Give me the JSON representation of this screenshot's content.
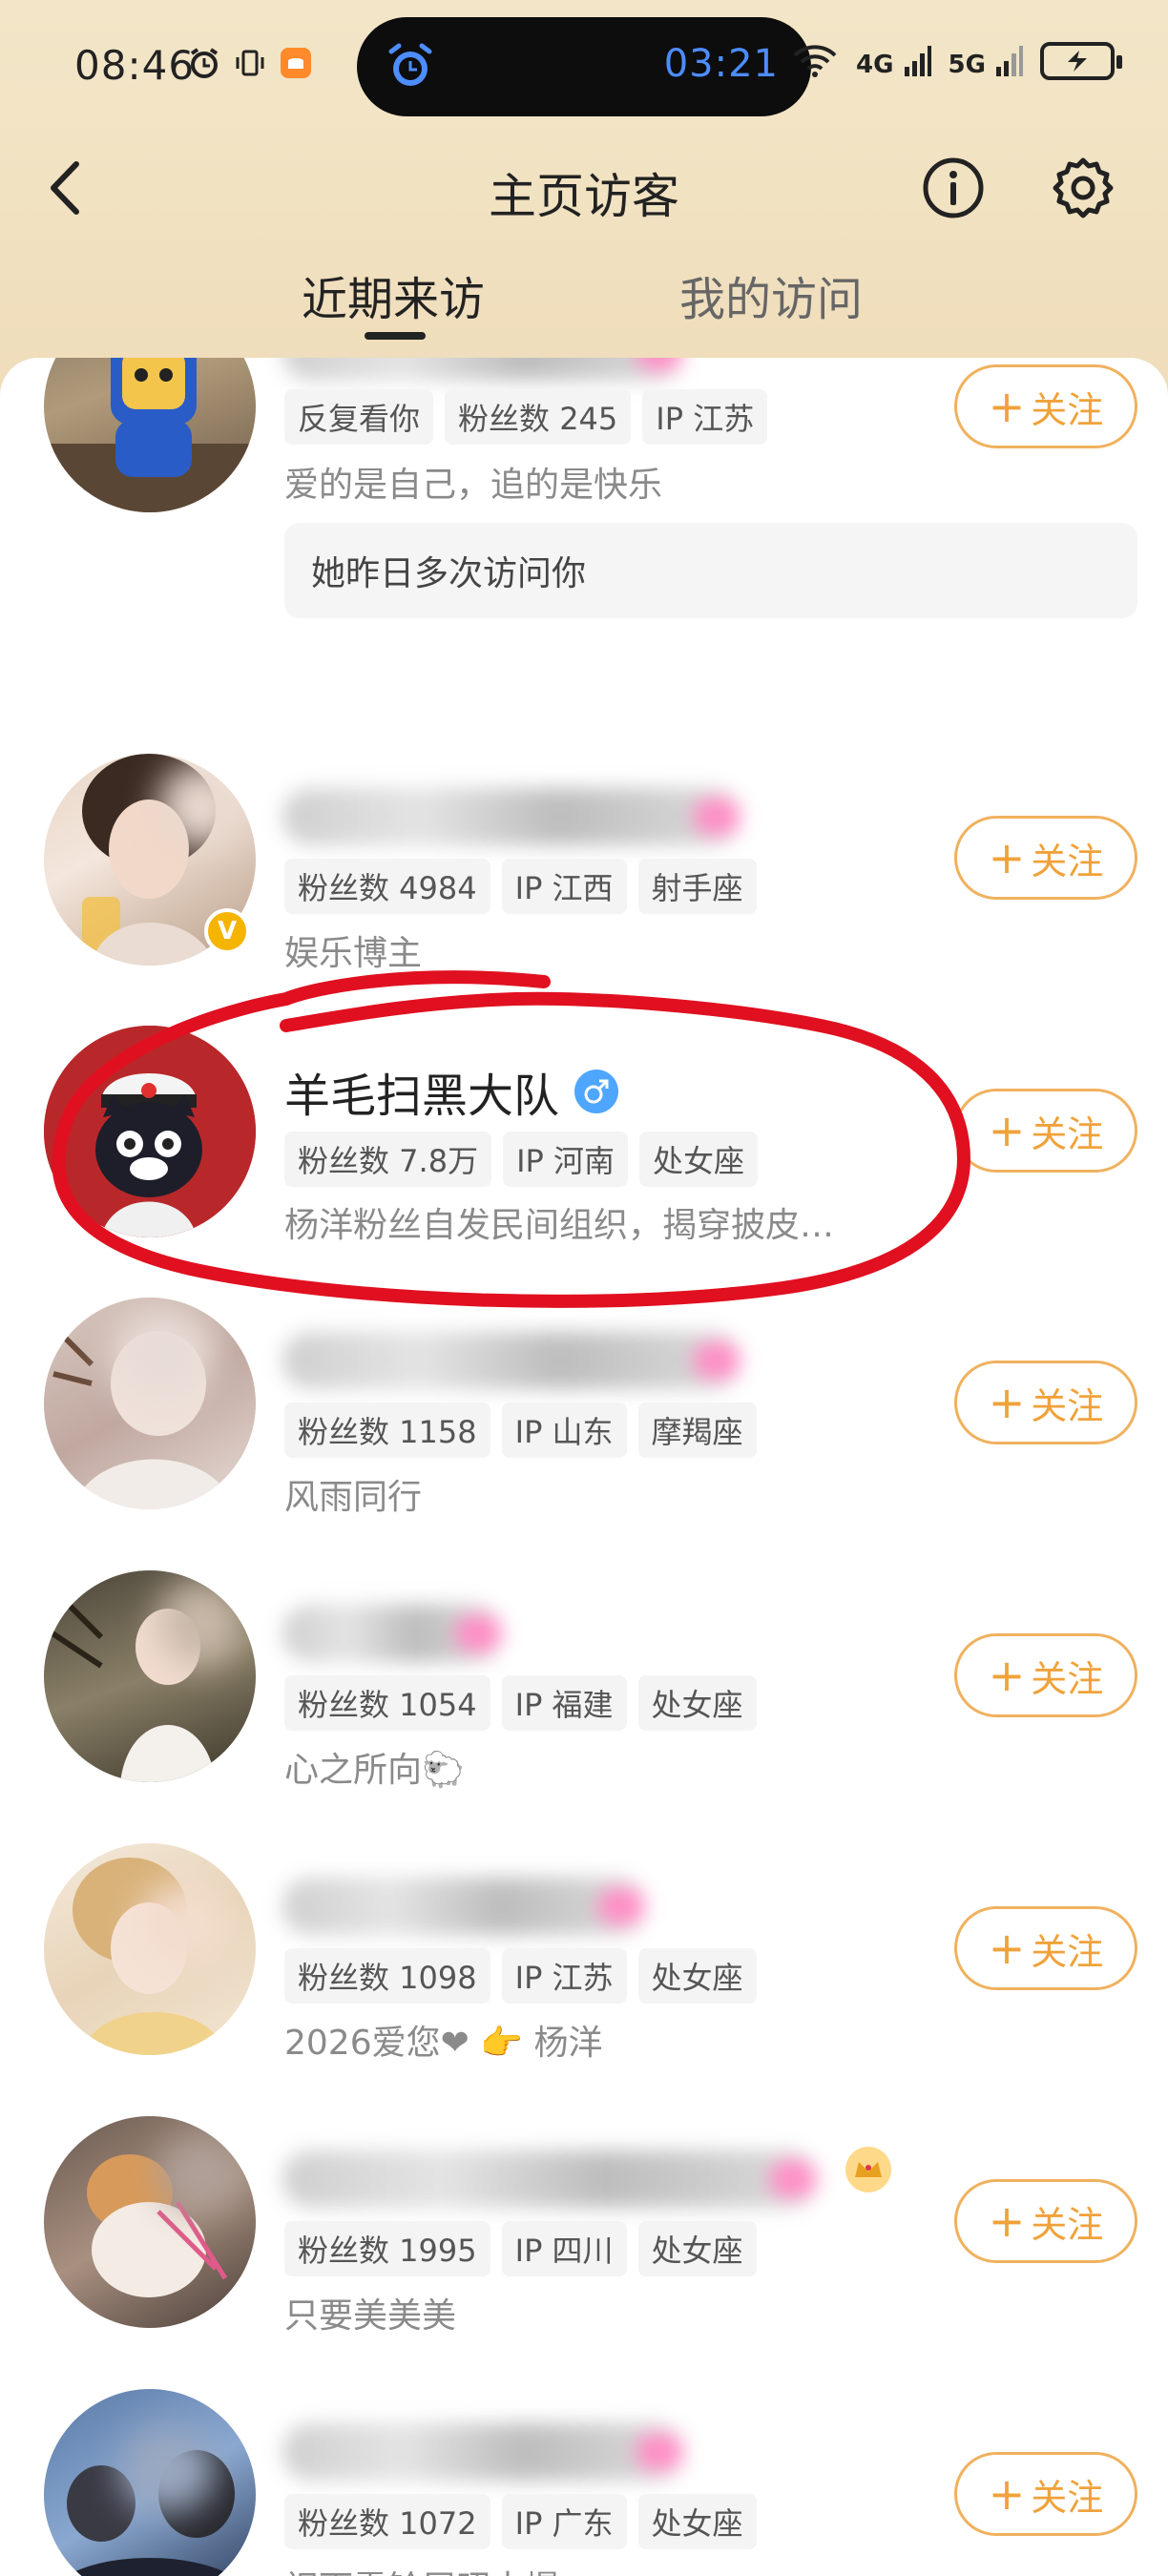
{
  "status_bar": {
    "time": "08:46",
    "timer": "03:21",
    "net1": "6",
    "net2": "4G",
    "net3": "5G"
  },
  "nav": {
    "title": "主页访客"
  },
  "tabs": [
    {
      "label": "近期来访",
      "active": true
    },
    {
      "label": "我的访问",
      "active": false
    }
  ],
  "follow_label": "关注",
  "visitors": [
    {
      "name": "",
      "tags": [
        "反复看你",
        "粉丝数 245",
        "IP 江苏"
      ],
      "desc": "爱的是自己，追的是快乐",
      "note": "她昨日多次访问你"
    },
    {
      "name": "",
      "tags": [
        "粉丝数 4984",
        "IP 江西",
        "射手座"
      ],
      "desc": "娱乐博主"
    },
    {
      "name": "羊毛扫黑大队",
      "tags": [
        "粉丝数 7.8万",
        "IP 河南",
        "处女座"
      ],
      "desc": "杨洋粉丝自发民间组织，揭穿披皮…"
    },
    {
      "name": "",
      "tags": [
        "粉丝数 1158",
        "IP 山东",
        "摩羯座"
      ],
      "desc": "风雨同行"
    },
    {
      "name": "",
      "tags": [
        "粉丝数 1054",
        "IP 福建",
        "处女座"
      ],
      "desc": "心之所向🐑"
    },
    {
      "name": "",
      "tags": [
        "粉丝数 1098",
        "IP 江苏",
        "处女座"
      ],
      "desc": "2026爱您❤ 👉 杨洋"
    },
    {
      "name": "",
      "tags": [
        "粉丝数 1995",
        "IP 四川",
        "处女座"
      ],
      "desc": "只要美美美"
    },
    {
      "name": "",
      "tags": [
        "粉丝数 1072",
        "IP 广东",
        "处女座"
      ],
      "desc": "祝雨霖铃展昭大爆"
    }
  ],
  "colors": {
    "accent": "#f0a23a",
    "header_bg": "#f1e2c2",
    "annotation": "#e01020"
  }
}
